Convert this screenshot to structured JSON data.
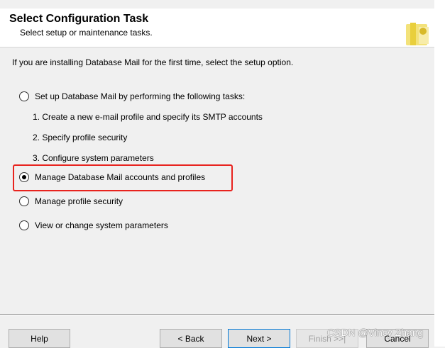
{
  "header": {
    "title": "Select Configuration Task",
    "subtitle": "Select setup or maintenance tasks."
  },
  "intro": "If you are installing Database Mail for the first time, select the setup option.",
  "options": [
    {
      "label": "Set up Database Mail by performing the following tasks:",
      "selected": false
    },
    {
      "label": "Manage Database Mail accounts and profiles",
      "selected": true
    },
    {
      "label": "Manage profile security",
      "selected": false
    },
    {
      "label": "View or change system parameters",
      "selected": false
    }
  ],
  "setup_steps": [
    "1. Create a new e-mail profile and specify its SMTP accounts",
    "2. Specify profile security",
    "3. Configure system parameters"
  ],
  "buttons": {
    "help": "Help",
    "back": "< Back",
    "next": "Next >",
    "finish": "Finish >>|",
    "cancel": "Cancel"
  },
  "watermark": "CSDN @Vincy Zhang",
  "colors": {
    "highlight": "#e8231e",
    "primary_border": "#0078d7"
  },
  "icon": "wizard-gear-icon"
}
